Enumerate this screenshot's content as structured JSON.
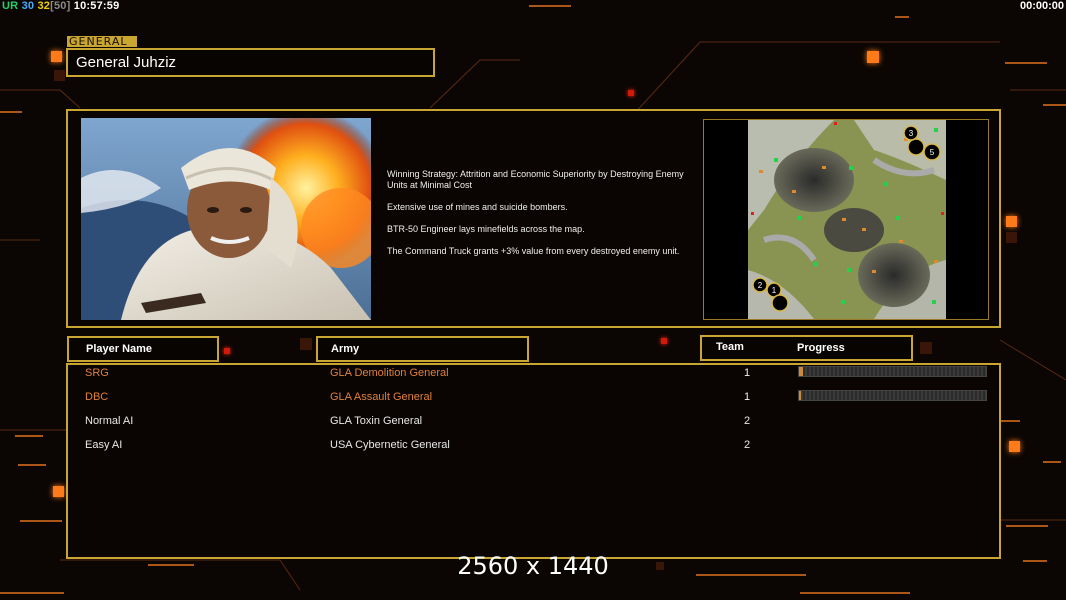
{
  "hud": {
    "ur_label": "UR",
    "stat_a": "30",
    "stat_b": "32",
    "stat_c": "[50]",
    "clock": "10:57:59",
    "timer": "00:00:00"
  },
  "general": {
    "tag": "GENERAL",
    "name": "General Juhziz",
    "strategy": [
      "Winning Strategy: Attrition and Economic Superiority by Destroying Enemy Units at Minimal Cost",
      "Extensive use of mines and suicide bombers.",
      "BTR-50 Engineer lays minefields across the map.",
      "The Command Truck grants +3% value from every destroyed enemy unit."
    ]
  },
  "minimap": {
    "start_positions": [
      "3",
      "5",
      "2",
      "1"
    ]
  },
  "table": {
    "headers": {
      "player": "Player Name",
      "army": "Army",
      "team": "Team",
      "progress": "Progress"
    },
    "rows": [
      {
        "name": "SRG",
        "army": "GLA Demolition General",
        "team": "1",
        "progress": 0.02,
        "human": true
      },
      {
        "name": "DBC",
        "army": "GLA Assault General",
        "team": "1",
        "progress": 0.01,
        "human": true
      },
      {
        "name": "Normal AI",
        "army": "GLA Toxin General",
        "team": "2",
        "human": false
      },
      {
        "name": "Easy AI",
        "army": "USA Cybernetic General",
        "team": "2",
        "human": false
      }
    ]
  },
  "overlay": {
    "resolution": "2560 x 1440"
  },
  "colors": {
    "accent_gold": "#c9a531",
    "human_player": "#e0803a",
    "glow_orange": "#ff7a18"
  }
}
